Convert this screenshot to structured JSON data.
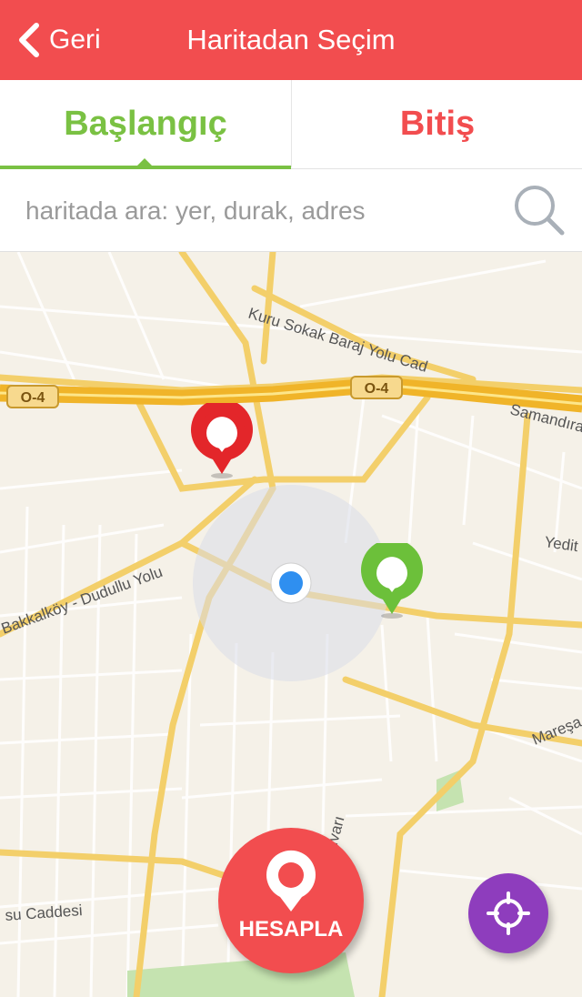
{
  "header": {
    "back_label": "Geri",
    "title": "Haritadan Seçim",
    "color": "#f24d4f"
  },
  "tabs": [
    {
      "label": "Başlangıç",
      "color": "#7ac143",
      "active": true
    },
    {
      "label": "Bitiş",
      "color": "#f24d4f",
      "active": false
    }
  ],
  "search": {
    "placeholder": "haritada ara: yer, durak, adres",
    "value": ""
  },
  "map": {
    "road_labels": [
      "O-4",
      "O-4",
      "Kuru Sokak Baraj Yolu Cad",
      "Samandıra",
      "Yedit",
      "Bakkalköy - Dudullu Yolu",
      "Mareşa",
      "ulvarı",
      "su Caddesi"
    ]
  },
  "actions": {
    "calculate_label": "HESAPLA",
    "calculate_color": "#f24d4f",
    "locate_color": "#8e3dbd"
  },
  "icons": {
    "back": "chevron-left-icon",
    "search": "search-icon",
    "start": "start-pin-icon",
    "end": "end-pin-icon",
    "current": "current-location-icon",
    "calculate": "pin-icon",
    "locate": "crosshair-icon"
  }
}
